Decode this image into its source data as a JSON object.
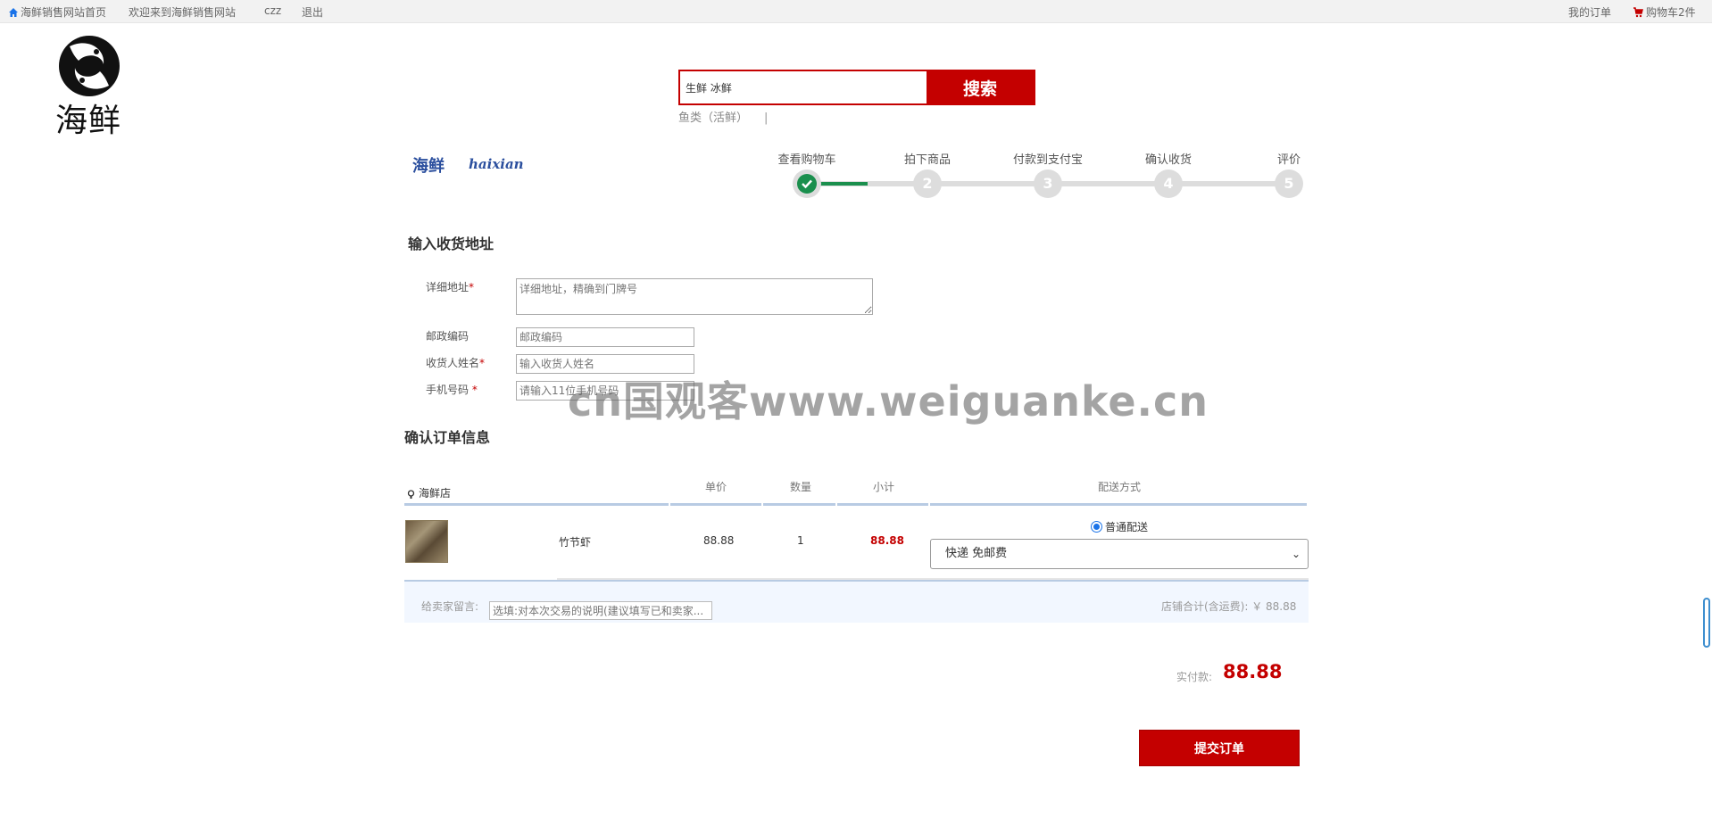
{
  "topbar": {
    "home_link": "海鲜销售网站首页",
    "welcome": "欢迎来到海鲜销售网站",
    "username": "czz",
    "logout": "退出",
    "my_orders": "我的订单",
    "cart": "购物车2件"
  },
  "logo": {
    "text": "海鲜"
  },
  "search": {
    "value": "生鲜 冰鲜",
    "button": "搜索",
    "hot_keyword": "鱼类（活鲜）",
    "separator": "|"
  },
  "brand": {
    "cn": "海鲜",
    "en": "haixian"
  },
  "steps": [
    {
      "label": "查看购物车",
      "num": "1",
      "done": true
    },
    {
      "label": "拍下商品",
      "num": "2",
      "done": false
    },
    {
      "label": "付款到支付宝",
      "num": "3",
      "done": false
    },
    {
      "label": "确认收货",
      "num": "4",
      "done": false
    },
    {
      "label": "评价",
      "num": "5",
      "done": false
    }
  ],
  "address": {
    "title": "输入收货地址",
    "detail_label": "详细地址",
    "detail_placeholder": "详细地址，精确到门牌号",
    "zip_label": "邮政编码",
    "zip_placeholder": "邮政编码",
    "name_label": "收货人姓名",
    "name_placeholder": "输入收货人姓名",
    "phone_label": "手机号码",
    "phone_placeholder": "请输入11位手机号码",
    "required_mark": "*"
  },
  "order": {
    "title": "确认订单信息",
    "shop": "海鲜店",
    "headers": {
      "price": "单价",
      "qty": "数量",
      "subtotal": "小计",
      "delivery": "配送方式"
    },
    "item": {
      "name": "竹节虾",
      "price": "88.88",
      "qty": "1",
      "subtotal": "88.88"
    },
    "delivery_radio": "普通配送",
    "delivery_select": "快递 免邮费",
    "message_label": "给卖家留言:",
    "message_placeholder": "选填:对本次交易的说明(建议填写已和卖家...",
    "shop_total": "店铺合计(含运费): ￥ 88.88"
  },
  "payment": {
    "label": "实付款:",
    "value": "88.88"
  },
  "submit": "提交订单",
  "watermark": "cn国观客www.weiguanke.cn",
  "colors": {
    "accent": "#c40000",
    "step_done": "#1a8f4d",
    "brand": "#2b4f9e"
  }
}
